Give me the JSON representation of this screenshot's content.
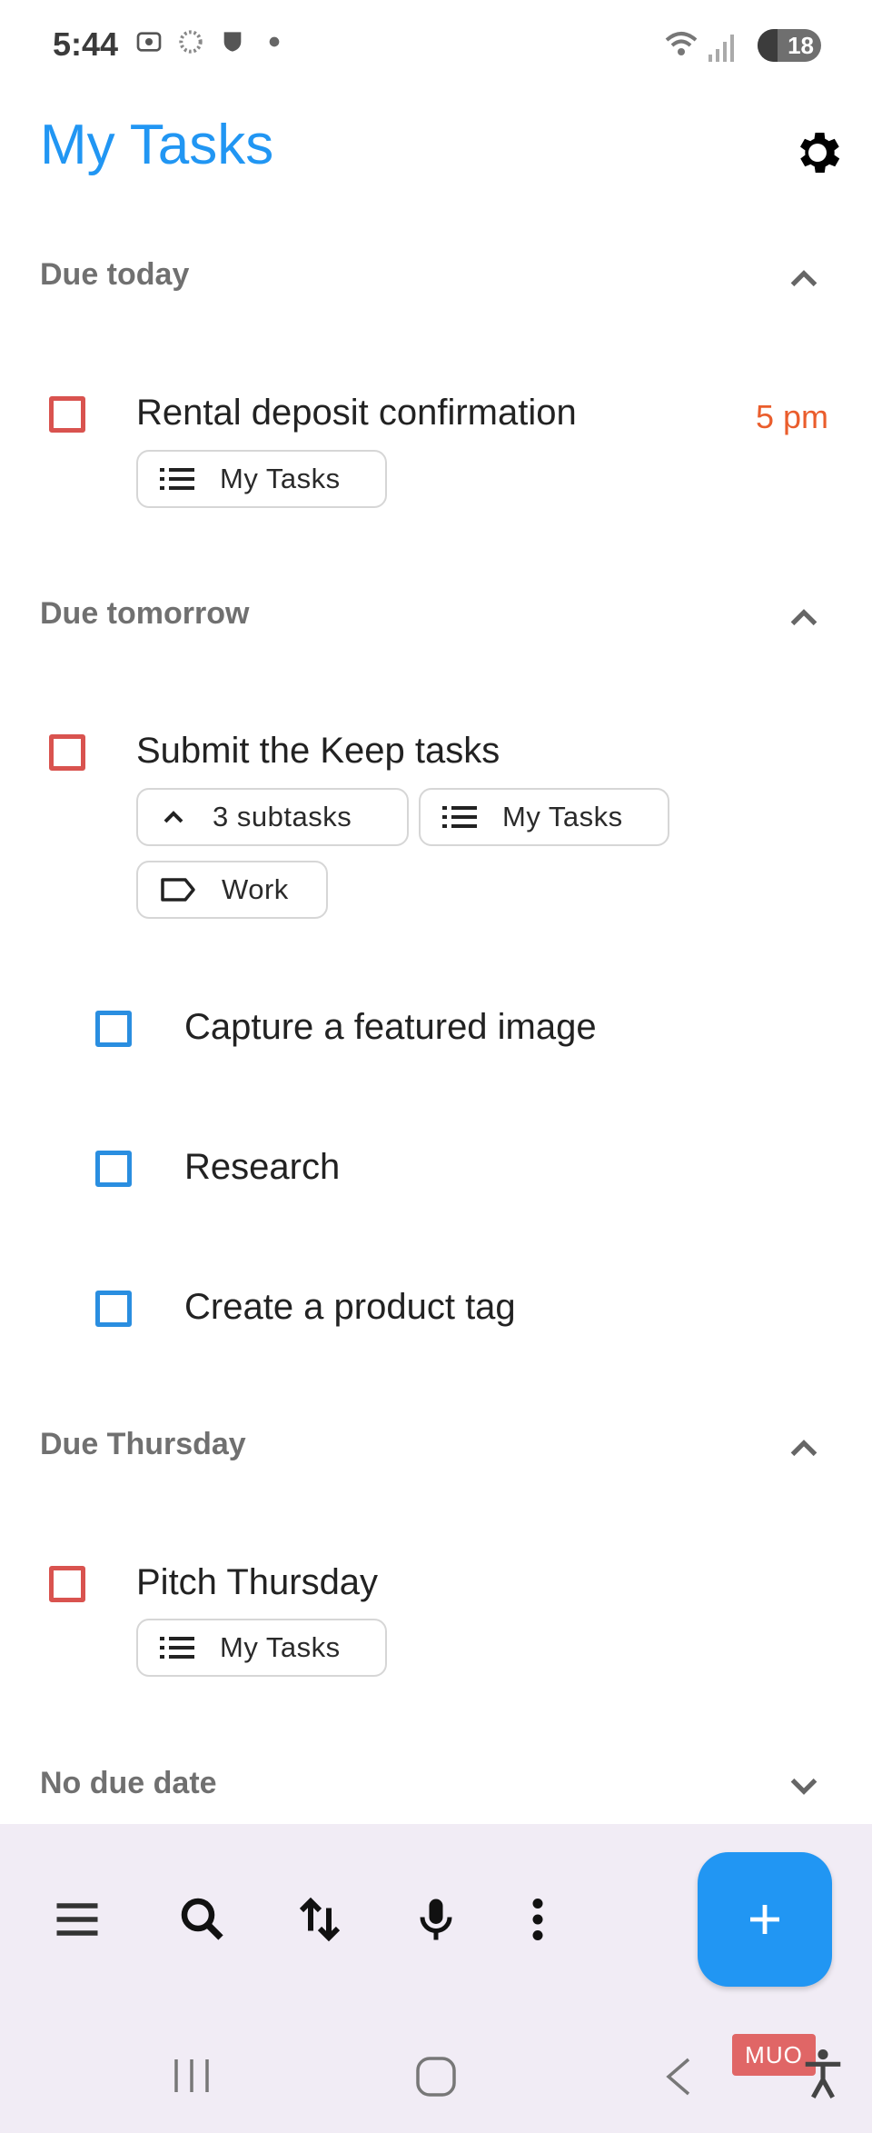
{
  "status_bar": {
    "time": "5:44",
    "battery": "18"
  },
  "header": {
    "title": "My Tasks"
  },
  "sections": [
    {
      "title": "Due today",
      "expanded": true
    },
    {
      "title": "Due tomorrow",
      "expanded": true
    },
    {
      "title": "Due Thursday",
      "expanded": true
    },
    {
      "title": "No due date",
      "expanded": false
    }
  ],
  "tasks": {
    "rental": {
      "title": "Rental deposit confirmation",
      "due": "5 pm",
      "list_chip": "My Tasks"
    },
    "keep": {
      "title": "Submit the Keep tasks",
      "subtasks_chip": "3 subtasks",
      "list_chip": "My Tasks",
      "tag_chip": "Work"
    },
    "subtasks": [
      {
        "title": "Capture a featured image"
      },
      {
        "title": "Research"
      },
      {
        "title": "Create a product tag"
      }
    ],
    "pitch": {
      "title": "Pitch Thursday",
      "list_chip": "My Tasks"
    }
  },
  "watermark": "MUO",
  "colors": {
    "accent": "#2196f3",
    "overdue_checkbox": "#d9534f",
    "subtask_checkbox": "#2a8ee0",
    "due_time": "#ea5d2c",
    "bottom_bar": "#f1ecf5"
  },
  "icons": [
    "settings-gear-icon",
    "chevron-up-icon",
    "chevron-down-icon",
    "list-icon",
    "label-icon",
    "menu-icon",
    "search-icon",
    "sort-icon",
    "mic-icon",
    "more-vert-icon",
    "plus-icon",
    "accessibility-icon"
  ]
}
